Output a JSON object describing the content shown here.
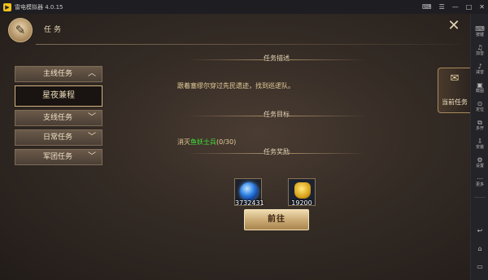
{
  "emulator": {
    "title": "雷电模拟器 4.0.15",
    "sidebar": [
      {
        "icon": "keyboard-icon",
        "label": "按键"
      },
      {
        "icon": "volume-up-icon",
        "label": "加音"
      },
      {
        "icon": "volume-down-icon",
        "label": "减音"
      },
      {
        "icon": "screenshot-icon",
        "label": "截图"
      },
      {
        "icon": "location-icon",
        "label": "定位"
      },
      {
        "icon": "multi-instance-icon",
        "label": "多开"
      },
      {
        "icon": "install-icon",
        "label": "安装"
      },
      {
        "icon": "settings-icon",
        "label": "设置"
      },
      {
        "icon": "more-icon",
        "label": "更多"
      }
    ]
  },
  "game": {
    "title": "任务",
    "menu": [
      {
        "label": "主线任务",
        "chevron": "up"
      },
      {
        "label": "星夜兼程",
        "selected": true
      },
      {
        "label": "支线任务",
        "chevron": "down"
      },
      {
        "label": "日常任务",
        "chevron": "down"
      },
      {
        "label": "军团任务",
        "chevron": "down"
      }
    ],
    "description": {
      "heading": "任务描述",
      "text": "跟着塞缪尔穿过先民遗迹，找到巡逻队。"
    },
    "objective": {
      "heading": "任务目标",
      "prefix": "消灭",
      "target": "鱼妖士兵",
      "progress": "(0/30)"
    },
    "rewards": {
      "heading": "任务奖励",
      "items": [
        {
          "icon": "blue-crystal-icon",
          "count": "3732431"
        },
        {
          "icon": "gold-coins-icon",
          "count": "19200"
        }
      ]
    },
    "goto_button": "前往",
    "current_quest_tab": "当前任务"
  }
}
